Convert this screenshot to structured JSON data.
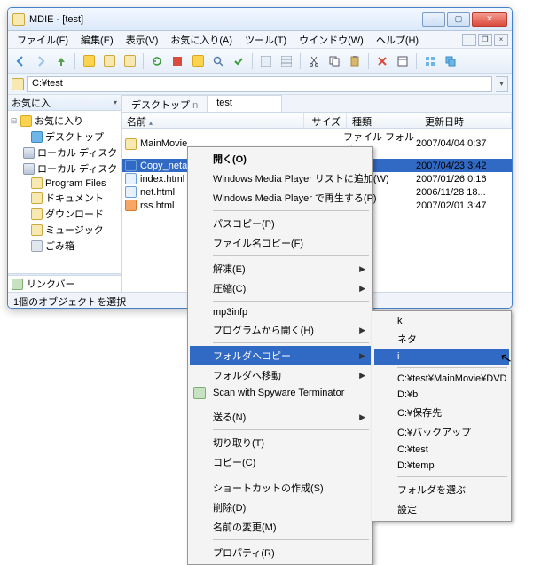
{
  "window": {
    "title": "MDIE - [test]"
  },
  "menus": [
    "ファイル(F)",
    "編集(E)",
    "表示(V)",
    "お気に入り(A)",
    "ツール(T)",
    "ウインドウ(W)",
    "ヘルプ(H)"
  ],
  "address": "C:¥test",
  "sidebar": {
    "header": "お気に入",
    "items": [
      {
        "tw": "⊟",
        "icon": "i-star",
        "label": "お気に入り"
      },
      {
        "tw": "",
        "icon": "i-desk",
        "label": "デスクトップ",
        "indent": 1
      },
      {
        "tw": "",
        "icon": "i-drv",
        "label": "ローカル ディスク",
        "indent": 1
      },
      {
        "tw": "",
        "icon": "i-drv",
        "label": "ローカル ディスク",
        "indent": 1
      },
      {
        "tw": "",
        "icon": "i-fold",
        "label": "Program Files",
        "indent": 1
      },
      {
        "tw": "",
        "icon": "i-fold",
        "label": "ドキュメント",
        "indent": 1
      },
      {
        "tw": "",
        "icon": "i-fold",
        "label": "ダウンロード",
        "indent": 1
      },
      {
        "tw": "",
        "icon": "i-fold",
        "label": "ミュージック",
        "indent": 1
      },
      {
        "tw": "",
        "icon": "i-bin",
        "label": "ごみ箱",
        "indent": 1
      }
    ],
    "link_header": "リンクバー"
  },
  "tabs": [
    {
      "label": "デスクトップ",
      "suffix": "n"
    },
    {
      "label": "test",
      "active": true
    }
  ],
  "columns": {
    "name": "名前",
    "size": "サイズ",
    "type": "種類",
    "date": "更新日時"
  },
  "rows": [
    {
      "icon": "i-fold",
      "name": "MainMovie",
      "size": "",
      "type": "ファイル フォルダ",
      "date": "2007/04/04 0:37"
    },
    {
      "icon": "i-avi",
      "name": "Copy_neta.av",
      "size": "",
      "type": "",
      "date": "2007/04/23 3:42",
      "selected": true
    },
    {
      "icon": "i-html",
      "name": "index.html",
      "size": "",
      "type": "",
      "date": "2007/01/26 0:16"
    },
    {
      "icon": "i-html",
      "name": "net.html",
      "size": "",
      "type": "",
      "date": "2006/11/28 18..."
    },
    {
      "icon": "i-rss",
      "name": "rss.html",
      "size": "",
      "type": "",
      "date": "2007/02/01 3:47"
    }
  ],
  "status": "1個のオブジェクトを選択",
  "ctx1": [
    {
      "t": "開く(O)",
      "bold": true
    },
    {
      "t": "Windows Media Player リストに追加(W)"
    },
    {
      "t": "Windows Media Player で再生する(P)"
    },
    {
      "sep": true
    },
    {
      "t": "パスコピー(P)"
    },
    {
      "t": "ファイル名コピー(F)"
    },
    {
      "sep": true
    },
    {
      "t": "解凍(E)",
      "sub": true
    },
    {
      "t": "圧縮(C)",
      "sub": true
    },
    {
      "sep": true
    },
    {
      "t": "mp3infp"
    },
    {
      "t": "プログラムから開く(H)",
      "sub": true
    },
    {
      "sep": true
    },
    {
      "t": "フォルダへコピー",
      "sub": true,
      "hl": true
    },
    {
      "t": "フォルダへ移動",
      "sub": true
    },
    {
      "t": "Scan with Spyware Terminator",
      "icon": "i-link"
    },
    {
      "sep": true
    },
    {
      "t": "送る(N)",
      "sub": true
    },
    {
      "sep": true
    },
    {
      "t": "切り取り(T)"
    },
    {
      "t": "コピー(C)"
    },
    {
      "sep": true
    },
    {
      "t": "ショートカットの作成(S)"
    },
    {
      "t": "削除(D)"
    },
    {
      "t": "名前の変更(M)"
    },
    {
      "sep": true
    },
    {
      "t": "プロパティ(R)"
    }
  ],
  "ctx2": [
    {
      "t": "k"
    },
    {
      "t": "ネタ"
    },
    {
      "t": "i",
      "hl": true
    },
    {
      "sep": true
    },
    {
      "t": "C:¥test¥MainMovie¥DVD"
    },
    {
      "t": "D:¥b"
    },
    {
      "t": "C:¥保存先"
    },
    {
      "t": "C:¥バックアップ"
    },
    {
      "t": "C:¥test"
    },
    {
      "t": "D:¥temp"
    },
    {
      "sep": true
    },
    {
      "t": "フォルダを選ぶ"
    },
    {
      "t": "設定"
    }
  ]
}
